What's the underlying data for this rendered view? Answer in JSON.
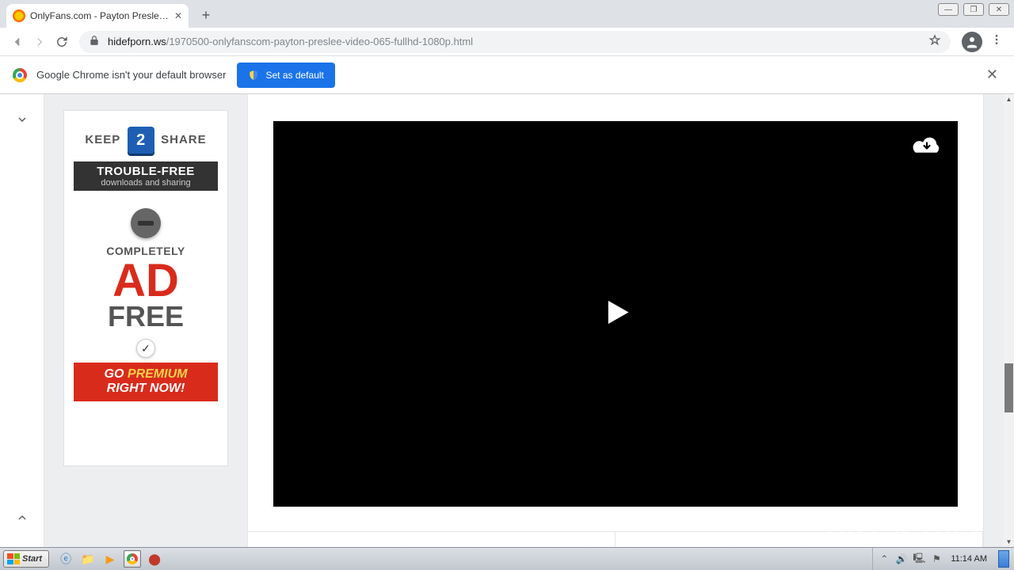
{
  "tab": {
    "title": "OnlyFans.com - Payton Preslee - Vid"
  },
  "url": {
    "host": "hidefporn.ws",
    "path": "/1970500-onlyfanscom-payton-preslee-video-065-fullhd-1080p.html"
  },
  "infobar": {
    "text": "Google Chrome isn't your default browser",
    "button": "Set as default"
  },
  "ad": {
    "keep": "KEEP",
    "share": "SHARE",
    "cube": "2",
    "trouble_big": "TROUBLE-FREE",
    "trouble_small": "downloads and sharing",
    "completely": "COMPLETELY",
    "ad": "AD",
    "free": "FREE",
    "go": "GO ",
    "premium": "PREMIUM",
    "now": "RIGHT NOW!"
  },
  "watermark": {
    "left": "ANY",
    "right": "RUN"
  },
  "taskbar": {
    "start": "Start",
    "clock": "11:14 AM"
  }
}
